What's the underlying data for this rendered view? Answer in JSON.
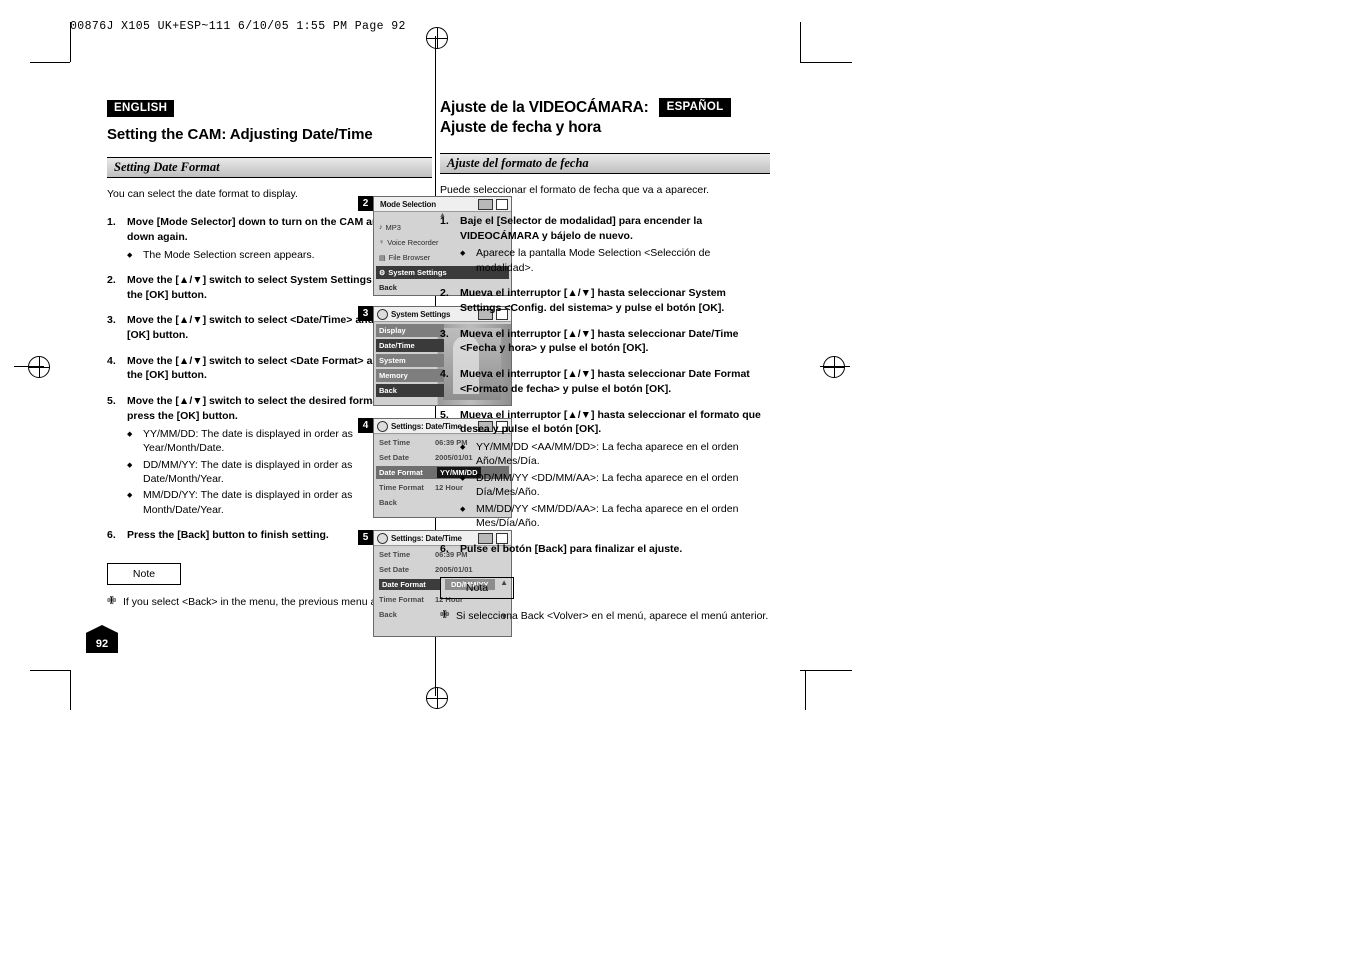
{
  "print_header": "00876J X105 UK+ESP~111   6/10/05  1:55 PM   Page  92",
  "page_number": "92",
  "english": {
    "badge": "ENGLISH",
    "title": "Setting the CAM: Adjusting Date/Time",
    "section_title": "Setting Date Format",
    "lead": "You can select the date format to display.",
    "steps": [
      {
        "num": "1.",
        "text": "Move [Mode Selector] down to turn on the CAM and move it down again.",
        "subs": [
          "The Mode Selection screen appears."
        ]
      },
      {
        "num": "2.",
        "text": "Move the [▲/▼] switch to select System Settings and press the [OK] button.",
        "subs": []
      },
      {
        "num": "3.",
        "text": "Move the [▲/▼] switch to select <Date/Time> and press the [OK] button.",
        "subs": []
      },
      {
        "num": "4.",
        "text": "Move the [▲/▼] switch to select <Date Format> and press the [OK] button.",
        "subs": []
      },
      {
        "num": "5.",
        "text": "Move the [▲/▼] switch to select the desired format and press the [OK] button.",
        "subs": [
          "YY/MM/DD: The date is displayed in order as Year/Month/Date.",
          "DD/MM/YY: The date is displayed in order as Date/Month/Year.",
          "MM/DD/YY: The date is displayed in order as Month/Date/Year."
        ]
      },
      {
        "num": "6.",
        "text": "Press the [Back] button to finish setting.",
        "subs": []
      }
    ],
    "note_label": "Note",
    "note_text": "If you select <Back> in the menu, the previous menu appears."
  },
  "spanish": {
    "badge": "ESPAÑOL",
    "title_line1": "Ajuste de la VIDEOCÁMARA:",
    "title_line2": "Ajuste de fecha y hora",
    "section_title": "Ajuste del formato de fecha",
    "lead": "Puede seleccionar el formato de fecha que va a aparecer.",
    "steps": [
      {
        "num": "1.",
        "text": "Baje el [Selector de modalidad] para encender la VIDEOCÁMARA y bájelo de nuevo.",
        "subs": [
          "Aparece la pantalla Mode Selection <Selección de modalidad>."
        ]
      },
      {
        "num": "2.",
        "text": "Mueva el interruptor [▲/▼] hasta seleccionar System Settings <Config. del sistema> y pulse el botón [OK].",
        "subs": []
      },
      {
        "num": "3.",
        "text": "Mueva el interruptor [▲/▼] hasta seleccionar Date/Time <Fecha y hora> y pulse el botón [OK].",
        "subs": []
      },
      {
        "num": "4.",
        "text": "Mueva el interruptor [▲/▼] hasta seleccionar Date Format <Formato de fecha> y pulse el botón [OK].",
        "subs": []
      },
      {
        "num": "5.",
        "text": "Mueva el interruptor [▲/▼] hasta seleccionar el formato que desea y pulse el botón [OK].",
        "subs": [
          "YY/MM/DD <AA/MM/DD>:  La fecha aparece en el orden Año/Mes/Día.",
          "DD/MM/YY <DD/MM/AA>:  La fecha aparece en el orden Día/Mes/Año.",
          "MM/DD/YY <MM/DD/AA>:  La fecha aparece en el orden Mes/Día/Año."
        ]
      },
      {
        "num": "6.",
        "text": "Pulse el botón [Back] para finalizar el ajuste.",
        "subs": []
      }
    ],
    "note_label": "Nota",
    "note_text": "Si selecciona Back <Volver> en el menú, aparece el menú anterior."
  },
  "screens": [
    {
      "index": "2",
      "title": "Mode Selection",
      "rows": [
        {
          "label": "MP3",
          "glyph": "♪",
          "state": "normal"
        },
        {
          "label": "Voice Recorder",
          "glyph": "♀",
          "state": "normal"
        },
        {
          "label": "File Browser",
          "glyph": "▤",
          "state": "normal"
        },
        {
          "label": "System Settings",
          "glyph": "⚙",
          "state": "selected"
        },
        {
          "label": "Back",
          "glyph": "",
          "state": "plain"
        }
      ]
    },
    {
      "index": "3",
      "title": "System Settings",
      "rows": [
        {
          "label": "Display",
          "state": "lite"
        },
        {
          "label": "Date/Time",
          "state": "selected"
        },
        {
          "label": "System",
          "state": "lite"
        },
        {
          "label": "Memory",
          "state": "lite"
        },
        {
          "label": "Back",
          "state": "lite"
        }
      ]
    },
    {
      "index": "4",
      "title": "Settings: Date/Time",
      "rows": [
        {
          "label": "Set Time",
          "value": "06:39 PM",
          "state": "normal"
        },
        {
          "label": "Set Date",
          "value": "2005/01/01",
          "state": "normal"
        },
        {
          "label": "Date Format",
          "value": "YY/MM/DD",
          "state": "highlight"
        },
        {
          "label": "Time Format",
          "value": "12 Hour",
          "state": "normal"
        },
        {
          "label": "Back",
          "value": "",
          "state": "normal"
        }
      ]
    },
    {
      "index": "5",
      "title": "Settings: Date/Time",
      "rows": [
        {
          "label": "Set Time",
          "value": "06:39 PM",
          "state": "normal"
        },
        {
          "label": "Set Date",
          "value": "2005/01/01",
          "state": "normal"
        },
        {
          "label": "Date Format",
          "value": "DD/MM/YY",
          "state": "highlight2"
        },
        {
          "label": "Time Format",
          "value": "12 Hour",
          "state": "normal"
        },
        {
          "label": "Back",
          "value": "",
          "state": "normal"
        }
      ]
    }
  ]
}
